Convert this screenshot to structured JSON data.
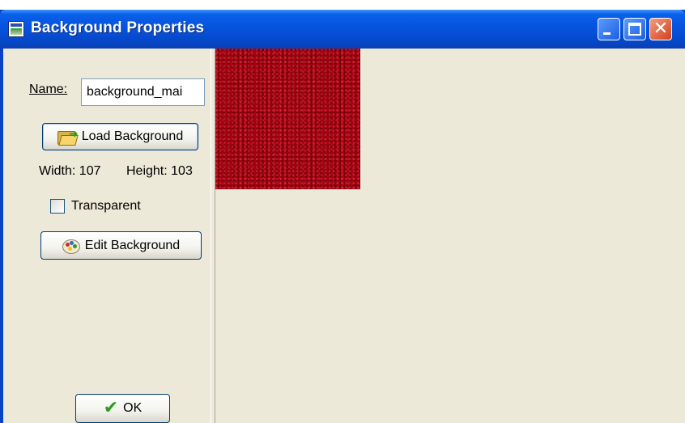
{
  "window": {
    "title": "Background Properties"
  },
  "titlebar_buttons": {
    "minimize_icon": "minimize-icon",
    "maximize_icon": "maximize-icon",
    "close_glyph": "✕"
  },
  "form": {
    "name_label": "Name:",
    "name_value": "background_mai",
    "load_button_label": "Load Background",
    "width_text": "Width: 107",
    "height_text": "Height: 103",
    "transparent_label": "Transparent",
    "transparent_checked": false,
    "edit_button_label": "Edit Background",
    "ok_button_label": "OK"
  },
  "icons": {
    "load": "folder-open-icon",
    "edit": "palette-icon",
    "ok": "checkmark-icon",
    "check_glyph": "✔"
  },
  "colors": {
    "titlebar": "#0652dc",
    "client_bg": "#ece9d8",
    "texture": "#a8000f",
    "close_button": "#d4401c"
  }
}
